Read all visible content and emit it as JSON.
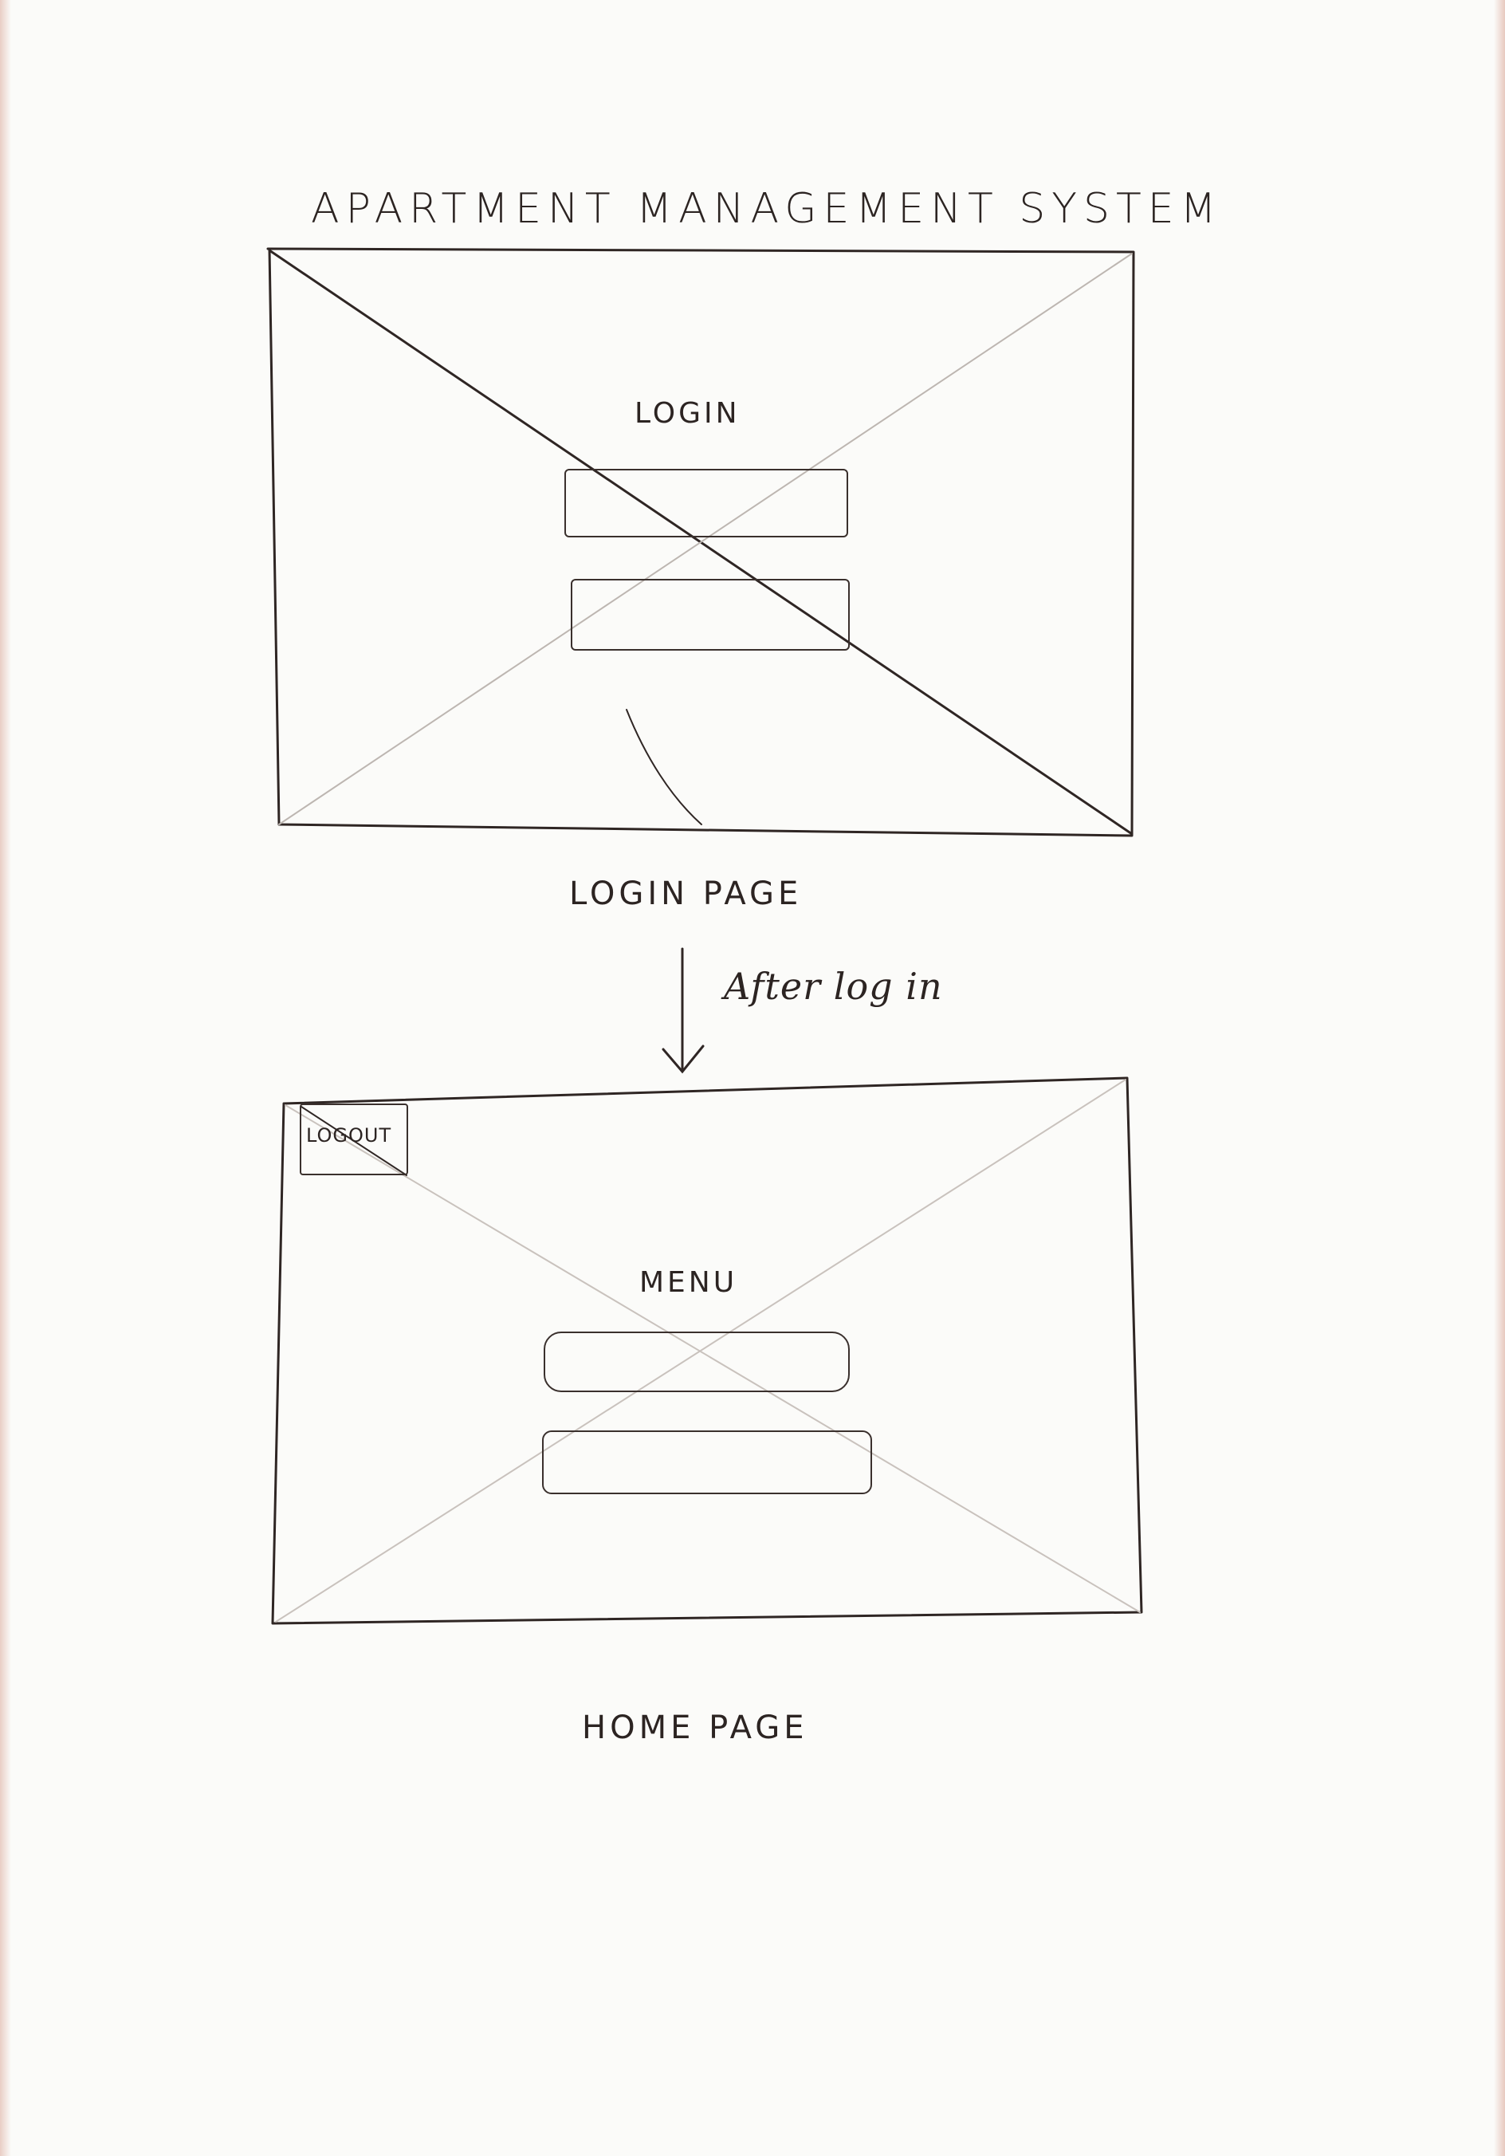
{
  "title": "APARTMENT MANAGEMENT SYSTEM",
  "login_page": {
    "heading": "LOGIN",
    "caption": "LOGIN PAGE"
  },
  "transition": {
    "label": "After log in"
  },
  "home_page": {
    "logout_label": "LOGOUT",
    "heading": "MENU",
    "caption": "HOME PAGE"
  },
  "colors": {
    "paper": "#fbfbf9",
    "ink": "#2a2220",
    "faint_ink": "#b9b2ad"
  }
}
